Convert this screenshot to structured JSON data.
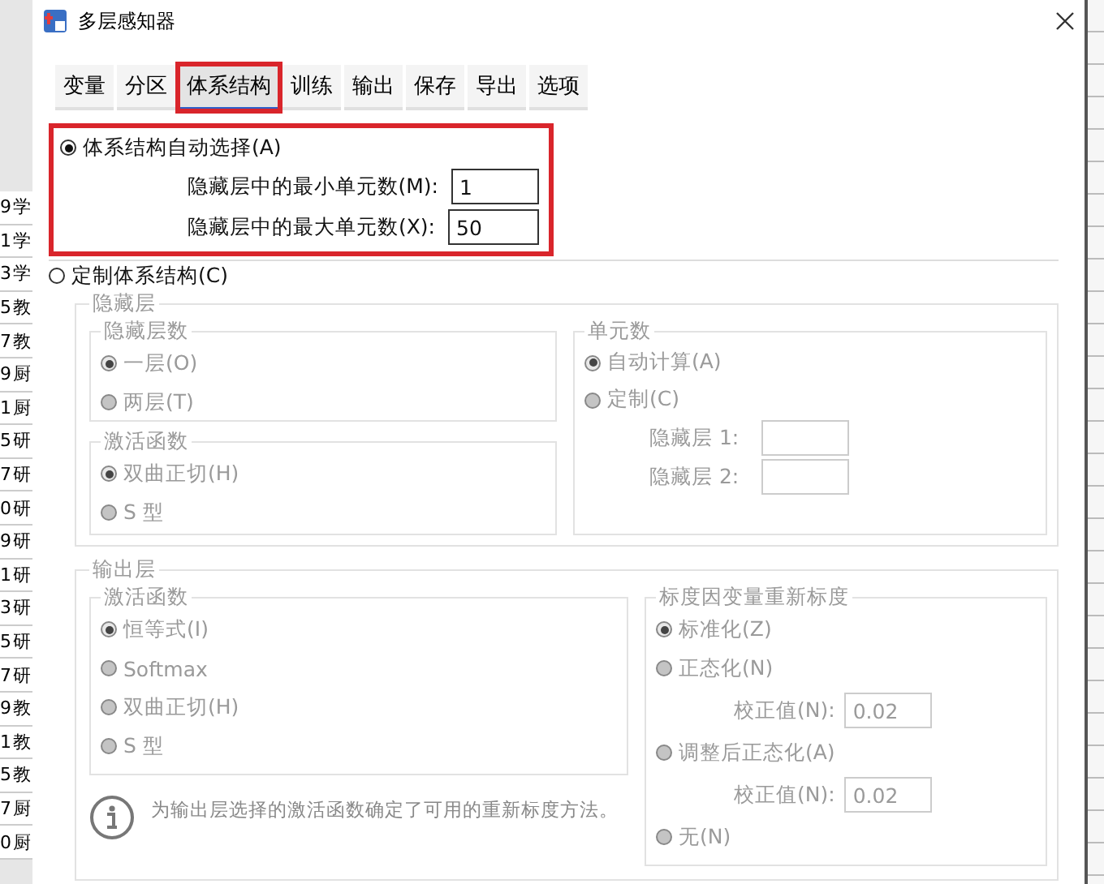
{
  "background_sheet": {
    "rows": [
      {
        "number": "9",
        "text": "学"
      },
      {
        "number": "1",
        "text": "学"
      },
      {
        "number": "3",
        "text": "学"
      },
      {
        "number": "5",
        "text": "教"
      },
      {
        "number": "7",
        "text": "教"
      },
      {
        "number": "9",
        "text": "厨"
      },
      {
        "number": "1",
        "text": "厨"
      },
      {
        "number": "5",
        "text": "研"
      },
      {
        "number": "7",
        "text": "研"
      },
      {
        "number": "0",
        "text": "研"
      },
      {
        "number": "9",
        "text": "研"
      },
      {
        "number": "1",
        "text": "研"
      },
      {
        "number": "3",
        "text": "研"
      },
      {
        "number": "5",
        "text": "研"
      },
      {
        "number": "7",
        "text": "研"
      },
      {
        "number": "9",
        "text": "教"
      },
      {
        "number": "1",
        "text": "教"
      },
      {
        "number": "5",
        "text": "教"
      },
      {
        "number": "7",
        "text": "厨"
      },
      {
        "number": "0",
        "text": "厨"
      }
    ]
  },
  "window": {
    "title": "多层感知器"
  },
  "tabs": [
    {
      "label": "变量",
      "selected": false,
      "highlighted": false
    },
    {
      "label": "分区",
      "selected": false,
      "highlighted": false
    },
    {
      "label": "体系结构",
      "selected": true,
      "highlighted": true
    },
    {
      "label": "训练",
      "selected": false,
      "highlighted": false
    },
    {
      "label": "输出",
      "selected": false,
      "highlighted": false
    },
    {
      "label": "保存",
      "selected": false,
      "highlighted": false
    },
    {
      "label": "导出",
      "selected": false,
      "highlighted": false
    },
    {
      "label": "选项",
      "selected": false,
      "highlighted": false
    }
  ],
  "auto_architecture": {
    "label": "体系结构自动选择(A)",
    "selected": true,
    "highlighted": true,
    "fields": [
      {
        "label": "隐藏层中的最小单元数(M):",
        "value": "1"
      },
      {
        "label": "隐藏层中的最大单元数(X):",
        "value": "50"
      }
    ]
  },
  "custom_architecture": {
    "label": "定制体系结构(C)",
    "selected": false,
    "disabled": true,
    "hidden_layer": {
      "title": "隐藏层",
      "layer_count": {
        "title": "隐藏层数",
        "options": [
          {
            "label": "一层(O)",
            "selected": true
          },
          {
            "label": "两层(T)",
            "selected": false
          }
        ]
      },
      "activation": {
        "title": "激活函数",
        "options": [
          {
            "label": "双曲正切(H)",
            "selected": true
          },
          {
            "label": "S 型",
            "selected": false
          }
        ]
      },
      "units": {
        "title": "单元数",
        "options": [
          {
            "label": "自动计算(A)",
            "selected": true
          },
          {
            "label": "定制(C)",
            "selected": false
          }
        ],
        "fields": [
          {
            "label": "隐藏层 1:"
          },
          {
            "label": "隐藏层 2:"
          }
        ]
      }
    },
    "output_layer": {
      "title": "输出层",
      "activation": {
        "title": "激活函数",
        "options": [
          {
            "label": "恒等式(I)",
            "selected": true
          },
          {
            "label": "Softmax",
            "selected": false
          },
          {
            "label": "双曲正切(H)",
            "selected": false
          },
          {
            "label": "S 型",
            "selected": false
          }
        ]
      },
      "note": "为输出层选择的激活函数确定了可用的重新标度方法。",
      "rescaling": {
        "title": "标度因变量重新标度",
        "items": [
          {
            "kind": "radio",
            "label": "标准化(Z)",
            "selected": true
          },
          {
            "kind": "radio",
            "label": "正态化(N)",
            "selected": false
          },
          {
            "kind": "field",
            "label": "校正值(N):",
            "value": "0.02"
          },
          {
            "kind": "radio",
            "label": "调整后正态化(A)",
            "selected": false
          },
          {
            "kind": "field",
            "label": "校正值(N):",
            "value": "0.02"
          },
          {
            "kind": "radio",
            "label": "无(N)",
            "selected": false
          }
        ]
      }
    }
  }
}
